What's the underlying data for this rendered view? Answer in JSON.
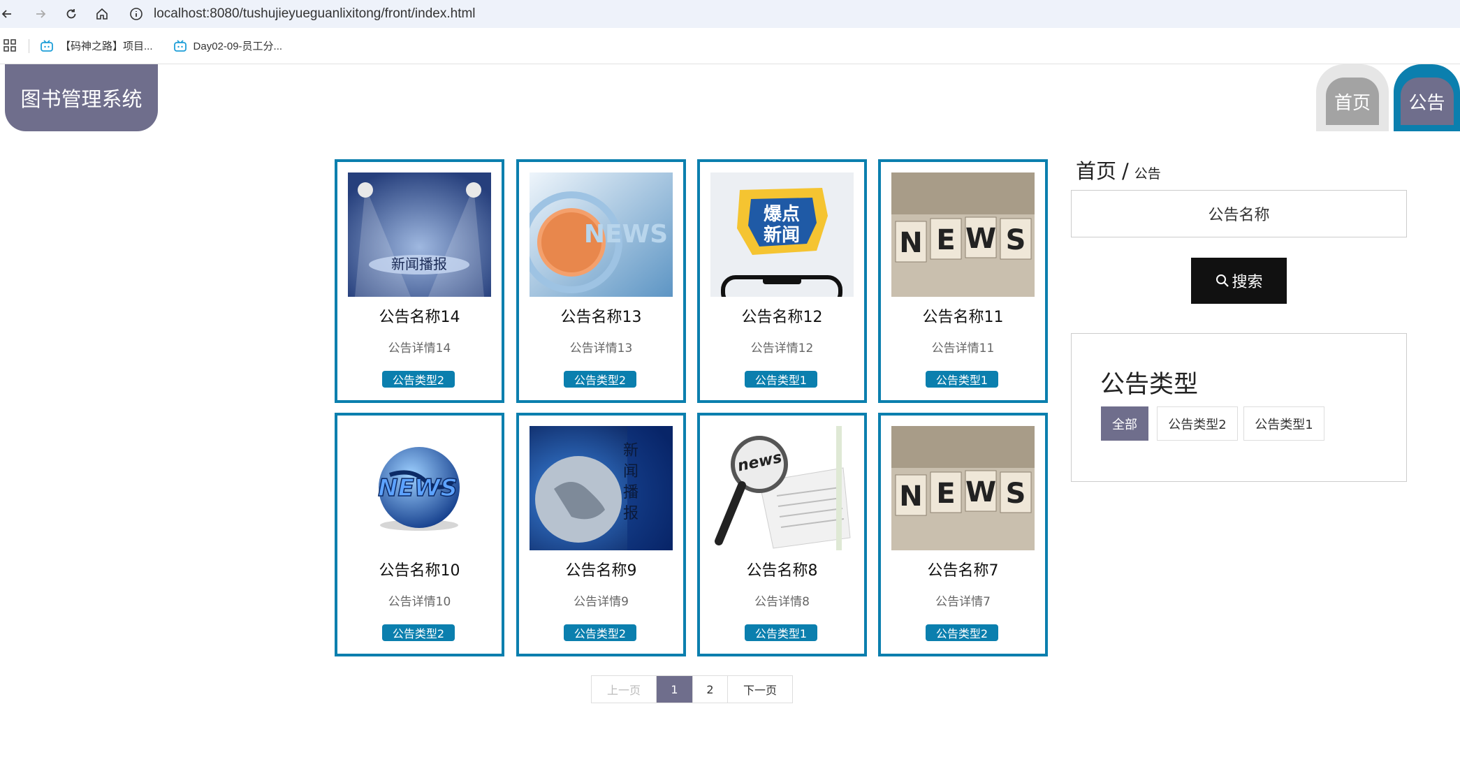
{
  "browser": {
    "url": "localhost:8080/tushujieyueguanlixitong/front/index.html",
    "bookmarks": [
      "【码神之路】项目...",
      "Day02-09-员工分..."
    ]
  },
  "header": {
    "logo": "图书管理系统",
    "nav": {
      "home": "首页",
      "notice": "公告"
    }
  },
  "cards": [
    {
      "image_label": "新闻播报",
      "title": "公告名称14",
      "detail": "公告详情14",
      "type": "公告类型2"
    },
    {
      "image_label": "NEWS",
      "title": "公告名称13",
      "detail": "公告详情13",
      "type": "公告类型2"
    },
    {
      "image_label": "爆点新闻",
      "title": "公告名称12",
      "detail": "公告详情12",
      "type": "公告类型1"
    },
    {
      "image_label": "NEWS",
      "title": "公告名称11",
      "detail": "公告详情11",
      "type": "公告类型1"
    },
    {
      "image_label": "NEWS",
      "title": "公告名称10",
      "detail": "公告详情10",
      "type": "公告类型2"
    },
    {
      "image_label": "新闻播报",
      "title": "公告名称9",
      "detail": "公告详情9",
      "type": "公告类型2"
    },
    {
      "image_label": "news",
      "title": "公告名称8",
      "detail": "公告详情8",
      "type": "公告类型1"
    },
    {
      "image_label": "NEWS",
      "title": "公告名称7",
      "detail": "公告详情7",
      "type": "公告类型2"
    }
  ],
  "pagination": {
    "prev": "上一页",
    "pages": [
      "1",
      "2"
    ],
    "current": "1",
    "next": "下一页"
  },
  "sidebar": {
    "breadcrumb": {
      "home": "首页",
      "separator": "/",
      "current": "公告"
    },
    "search_placeholder": "公告名称",
    "search_button": "搜索",
    "type_title": "公告类型",
    "type_options": [
      "全部",
      "公告类型2",
      "公告类型1"
    ],
    "type_selected": "全部"
  },
  "colors": {
    "accent_blue": "#0b7fae",
    "purple_gray": "#6f6e8c",
    "search_button": "#111111"
  }
}
